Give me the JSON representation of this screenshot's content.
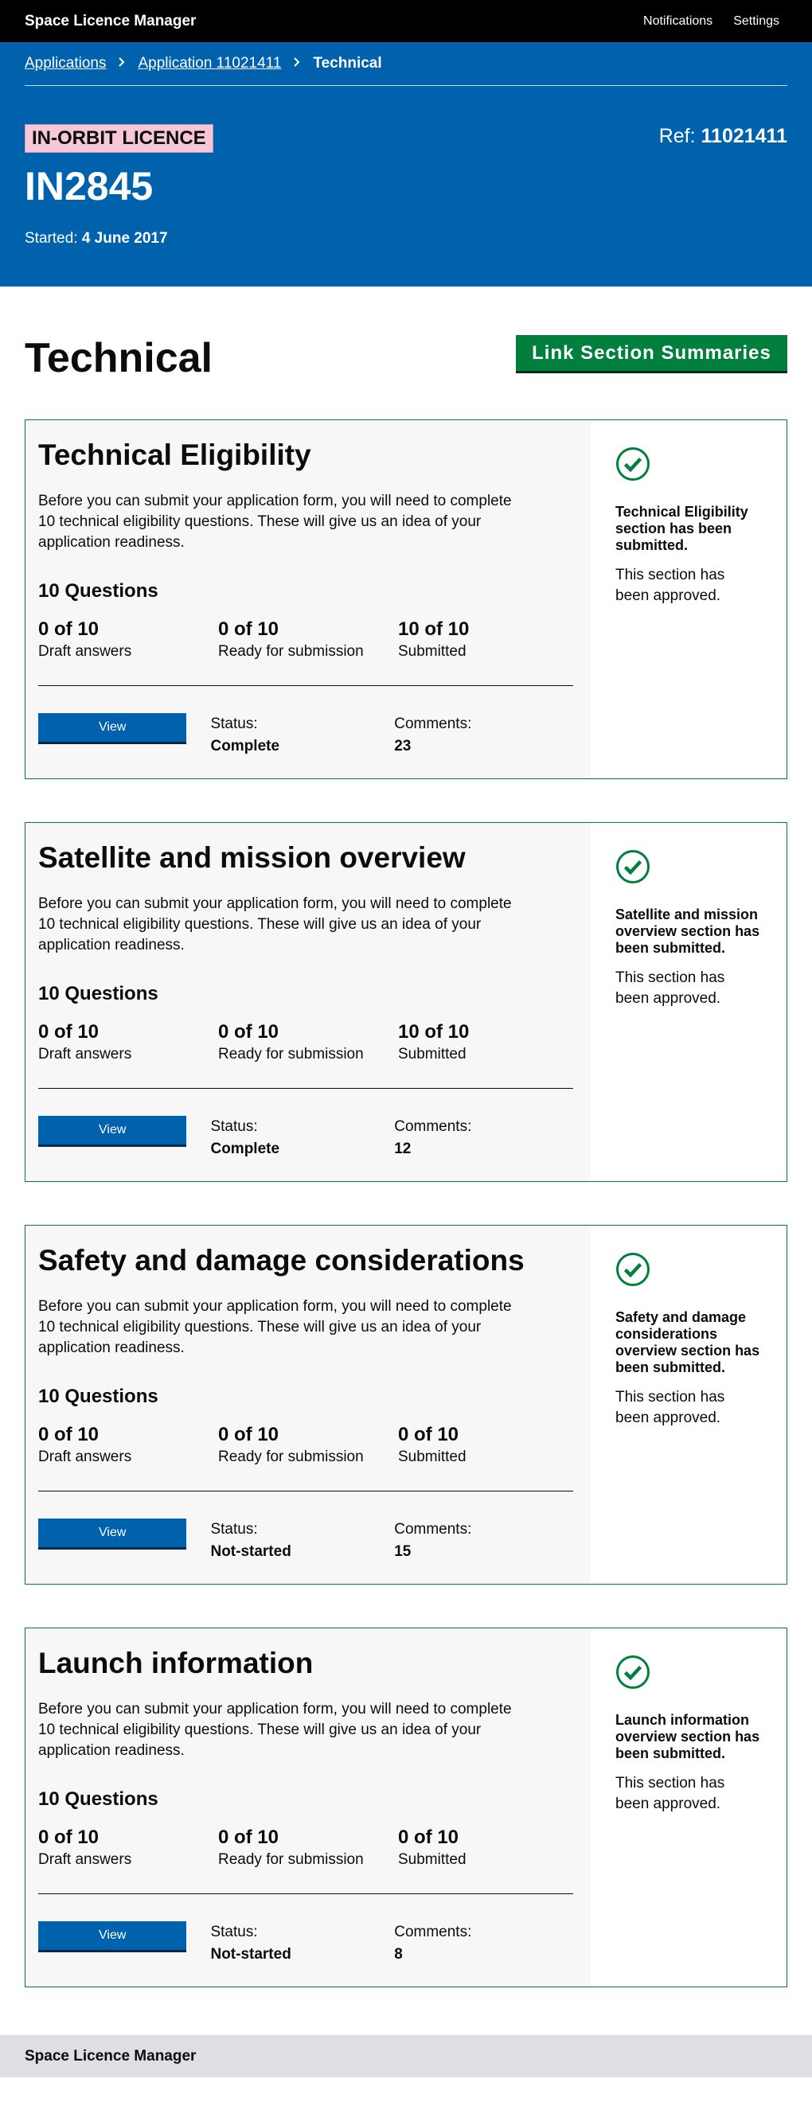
{
  "header": {
    "brand": "Space Licence Manager",
    "nav": [
      "Notifications",
      "Settings"
    ]
  },
  "breadcrumb": [
    "Applications",
    "Application 11021411",
    "Technical"
  ],
  "licence": {
    "type": "IN-ORBIT LICENCE",
    "ref_label": "Ref:",
    "ref": "11021411",
    "id": "IN2845",
    "started_label": "Started:",
    "started": "4 June 2017"
  },
  "page": {
    "title": "Technical",
    "link_button": "Link Section Summaries"
  },
  "sections": [
    {
      "title": "Technical Eligibility",
      "description": "Before you can submit your application form, you will need to complete 10 technical eligibility questions. These will give us an idea of your application readiness.",
      "questions": "10 Questions",
      "stats": [
        {
          "value": "0 of 10",
          "label": "Draft answers"
        },
        {
          "value": "0 of 10",
          "label": "Ready for submission"
        },
        {
          "value": "10 of 10",
          "label": "Submitted"
        }
      ],
      "view": "View",
      "status_label": "Status:",
      "status": "Complete",
      "comments_label": "Comments:",
      "comments": "23",
      "side_title": "Technical Eligibility section has been submitted.",
      "side_note": "This section has been approved."
    },
    {
      "title": "Satellite and mission overview",
      "description": "Before you can submit your application form, you will need to complete 10 technical eligibility questions. These will give us an idea of your application readiness.",
      "questions": "10 Questions",
      "stats": [
        {
          "value": "0 of 10",
          "label": "Draft answers"
        },
        {
          "value": "0 of 10",
          "label": "Ready for submission"
        },
        {
          "value": "10 of 10",
          "label": "Submitted"
        }
      ],
      "view": "View",
      "status_label": "Status:",
      "status": "Complete",
      "comments_label": "Comments:",
      "comments": "12",
      "side_title": "Satellite and mission overview section has been submitted.",
      "side_note": "This section has been approved."
    },
    {
      "title": "Safety and damage considerations",
      "description": "Before you can submit your application form, you will need to complete 10 technical eligibility questions. These will give us an idea of your application readiness.",
      "questions": "10 Questions",
      "stats": [
        {
          "value": "0 of 10",
          "label": "Draft answers"
        },
        {
          "value": "0 of 10",
          "label": "Ready for submission"
        },
        {
          "value": "0 of 10",
          "label": "Submitted"
        }
      ],
      "view": "View",
      "status_label": "Status:",
      "status": "Not-started",
      "comments_label": "Comments:",
      "comments": "15",
      "side_title": "Safety and damage considerations overview section has been submitted.",
      "side_note": "This section has been approved."
    },
    {
      "title": "Launch information",
      "description": "Before you can submit your application form, you will need to complete 10 technical eligibility questions. These will give us an idea of your application readiness.",
      "questions": "10 Questions",
      "stats": [
        {
          "value": "0 of 10",
          "label": "Draft answers"
        },
        {
          "value": "0 of 10",
          "label": "Ready for submission"
        },
        {
          "value": "0 of 10",
          "label": "Submitted"
        }
      ],
      "view": "View",
      "status_label": "Status:",
      "status": "Not-started",
      "comments_label": "Comments:",
      "comments": "8",
      "side_title": "Launch information overview section has been submitted.",
      "side_note": "This section has been approved."
    }
  ],
  "footer": {
    "brand": "Space Licence Manager"
  },
  "colors": {
    "header_bg": "#000000",
    "banner_bg": "#0061ad",
    "licence_tag_bg": "#f7c6d9",
    "accent_green": "#00803c",
    "button_blue": "#0061ad",
    "footer_bg": "#dedfe2"
  },
  "icons": {
    "section_status": "check-circle-icon",
    "breadcrumb_separator": "chevron-right-icon"
  }
}
